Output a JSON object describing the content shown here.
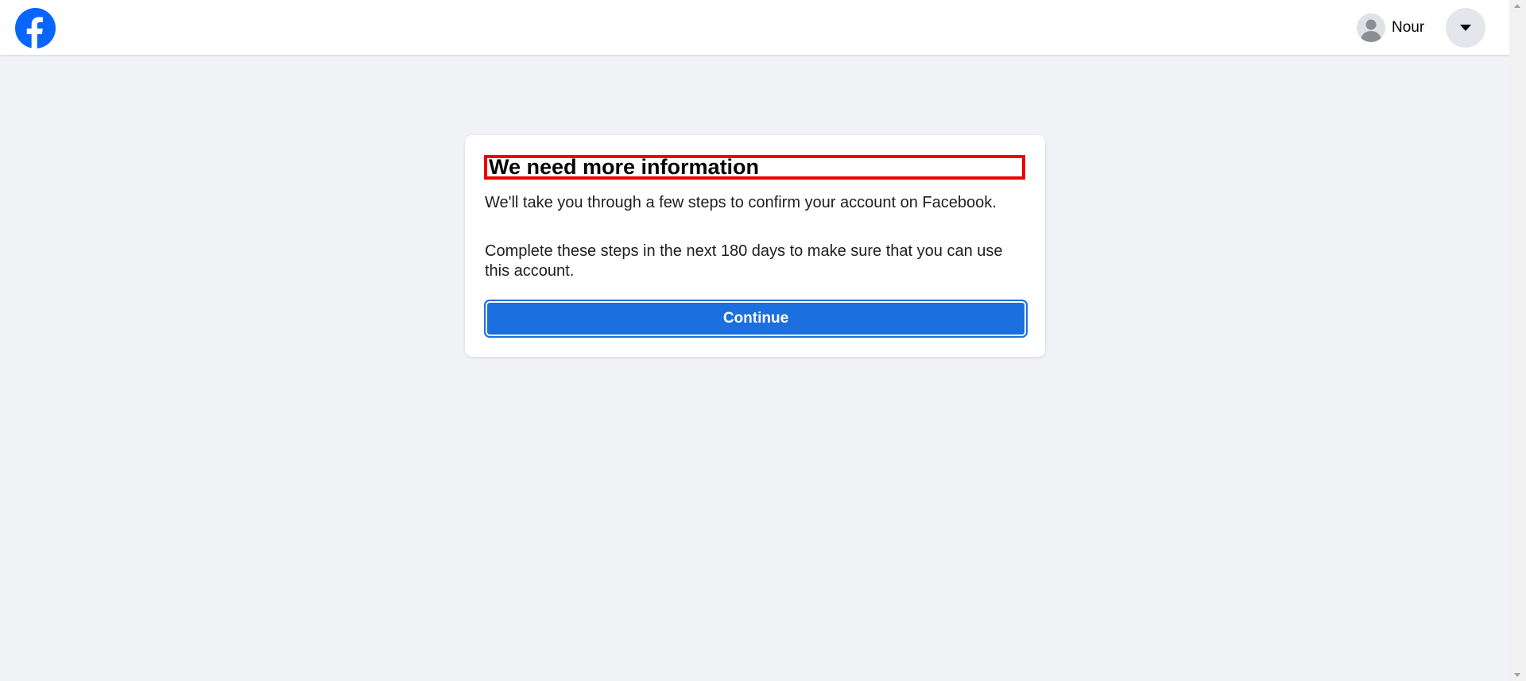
{
  "header": {
    "logo_icon": "facebook-logo-icon",
    "profile_name": "Nour",
    "avatar_icon": "user-avatar-icon",
    "menu_icon": "caret-down-icon",
    "brand_color": "#0866ff"
  },
  "card": {
    "title": "We need more information",
    "paragraph_1": "We'll take you through a few steps to confirm your account on Facebook.",
    "paragraph_2": "Complete these steps in the next 180 days to make sure that you can use this account.",
    "continue_label": "Continue",
    "button_color": "#1b6fde",
    "highlight_color": "#ee0000"
  }
}
